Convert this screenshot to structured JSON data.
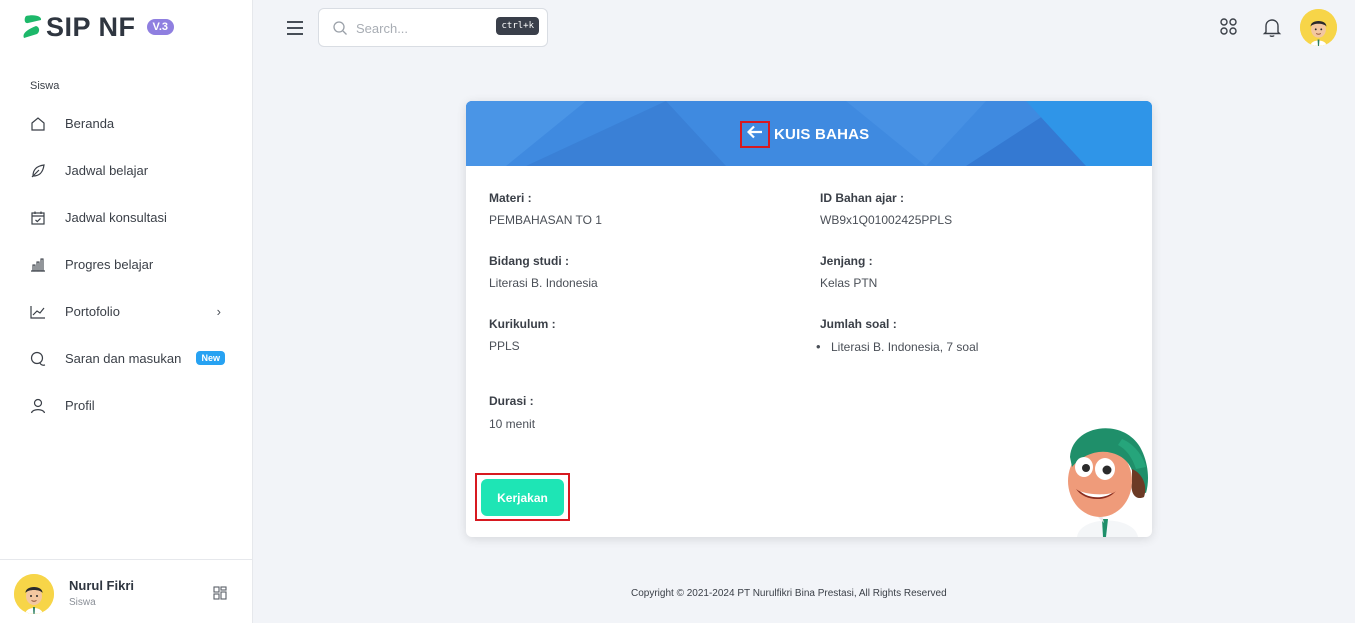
{
  "app": {
    "logo_text": "SIP NF",
    "version": "V.3",
    "brand_color": "#1db86a",
    "accent_color": "#3f8ae0"
  },
  "sidebar": {
    "section_label": "Siswa",
    "items": [
      {
        "label": "Beranda",
        "icon": "home-icon"
      },
      {
        "label": "Jadwal belajar",
        "icon": "leaf-icon"
      },
      {
        "label": "Jadwal konsultasi",
        "icon": "calendar-check-icon"
      },
      {
        "label": "Progres belajar",
        "icon": "bar-chart-icon"
      },
      {
        "label": "Portofolio",
        "icon": "line-chart-icon"
      },
      {
        "label": "Saran dan masukan",
        "icon": "chat-icon",
        "badge": "New"
      },
      {
        "label": "Profil",
        "icon": "user-icon"
      }
    ],
    "footer": {
      "name": "Nurul Fikri",
      "role": "Siswa"
    }
  },
  "topbar": {
    "search_placeholder": "Search...",
    "search_shortcut": "ctrl+k"
  },
  "card": {
    "title": "KUIS BAHAS",
    "fields": {
      "materi_label": "Materi :",
      "materi_value": "PEMBAHASAN TO 1",
      "id_label": "ID Bahan ajar :",
      "id_value": "WB9x1Q01002425PPLS",
      "bidang_label": "Bidang studi :",
      "bidang_value": "Literasi B. Indonesia",
      "jenjang_label": "Jenjang :",
      "jenjang_value": "Kelas PTN",
      "kurikulum_label": "Kurikulum :",
      "kurikulum_value": "PPLS",
      "jumlah_label": "Jumlah soal :",
      "jumlah_items": [
        "Literasi B. Indonesia, 7 soal"
      ],
      "durasi_label": "Durasi :",
      "durasi_value": "10 menit"
    },
    "action_label": "Kerjakan",
    "action_color": "#1ee5b5"
  },
  "footer": {
    "copyright": "Copyright © 2021-2024 PT Nurulfikri Bina Prestasi, All Rights Reserved"
  }
}
